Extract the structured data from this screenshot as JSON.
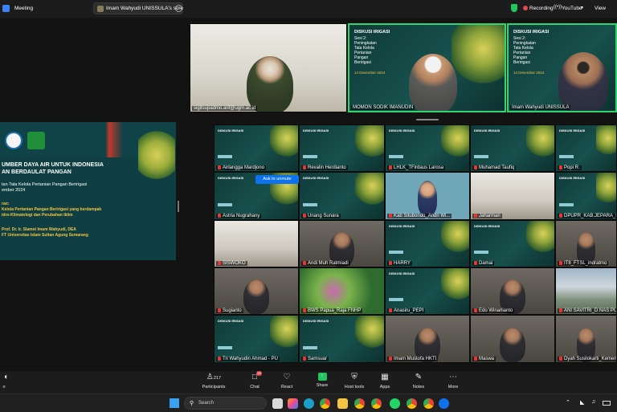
{
  "topbar": {
    "app_icon": "zoom-shield-icon",
    "meeting_label": "Meeting",
    "share_label": "Imam Wahyudi UNISSULA's scre",
    "share_more": "more-icon",
    "recording_label": "Recording",
    "youtube_label": "YouTube",
    "view_label": "View"
  },
  "slide_main": {
    "line1": "UMBER DAYA AIR UNTUK INDONESIA",
    "line2": "AN BERDAULAT PANGAN",
    "line3": "tan Tata Kelola Pertanian Pangan Beririgasi",
    "line4": "ember 2024",
    "line5": "ran:",
    "line6": "Kelola Pertanian Pangan Beririgasi yang berdampak",
    "line7": "idro-Klimatologi dan Perubahan Iklim",
    "line8": "Prof. Dr. Ir. Slamet Imam Wahyudi, DEA",
    "line9": "FT Universitas Islam Sultan Agung Semarang"
  },
  "slide_small": {
    "title": "DISKUSI IRIGASI",
    "sesi": "Sesi 2:",
    "topic": "Peningkatan Tata Kelola Pertanian Pangan Beririgasi",
    "date": "14 Desember 2024"
  },
  "speakers": [
    {
      "name": "sigitsupadmo.arif@ugm.ac.id"
    },
    {
      "name": "MOMON SODIK IMANUDIN"
    },
    {
      "name": "Imam Wahyudi UNISSULA"
    }
  ],
  "ask_to_unmute": "Ask to unmute",
  "grid": [
    [
      "Airlangga Mardjono",
      "Revalin Herdianto",
      "LHLK_TFirdaus Larosa",
      "Muhamad Taufiq",
      "Popi R."
    ],
    [
      "Astria Nugrahany",
      "Unang Sunara",
      "Kab Situbondo_Andri Wi...",
      "Jaharman",
      "DPUPR_KAB.JEPARA_LAT"
    ],
    [
      "SISWOKO",
      "Andi Muh Ratmiadi",
      "HARRY",
      "Damai",
      "IT8_FTSL_indratmo"
    ],
    [
      "Sugianto",
      "BWS Papua_Raja FNHP",
      "Anasiru_PEPI",
      "Edo Winarlianto",
      "ANI SAVITRI_D NAS PUS"
    ],
    [
      "Tri Wahyudin Ahmad - PU",
      "Samsuar",
      "Imam Mustofa HKTI",
      "Maswa",
      "Dyah Susilokarti_Kemen"
    ]
  ],
  "toolbar": {
    "left_label": "o",
    "participants_label": "Participants",
    "participants_count": "217",
    "chat_label": "Chat",
    "chat_badge": "16",
    "react_label": "React",
    "share_label": "Share",
    "host_tools_label": "Host tools",
    "apps_label": "Apps",
    "notes_label": "Notes",
    "more_label": "More"
  },
  "taskbar": {
    "search_placeholder": "Search"
  },
  "colors": {
    "accent": "#0e72ed",
    "share_green": "#22c55e",
    "recording_red": "#e5484d"
  }
}
